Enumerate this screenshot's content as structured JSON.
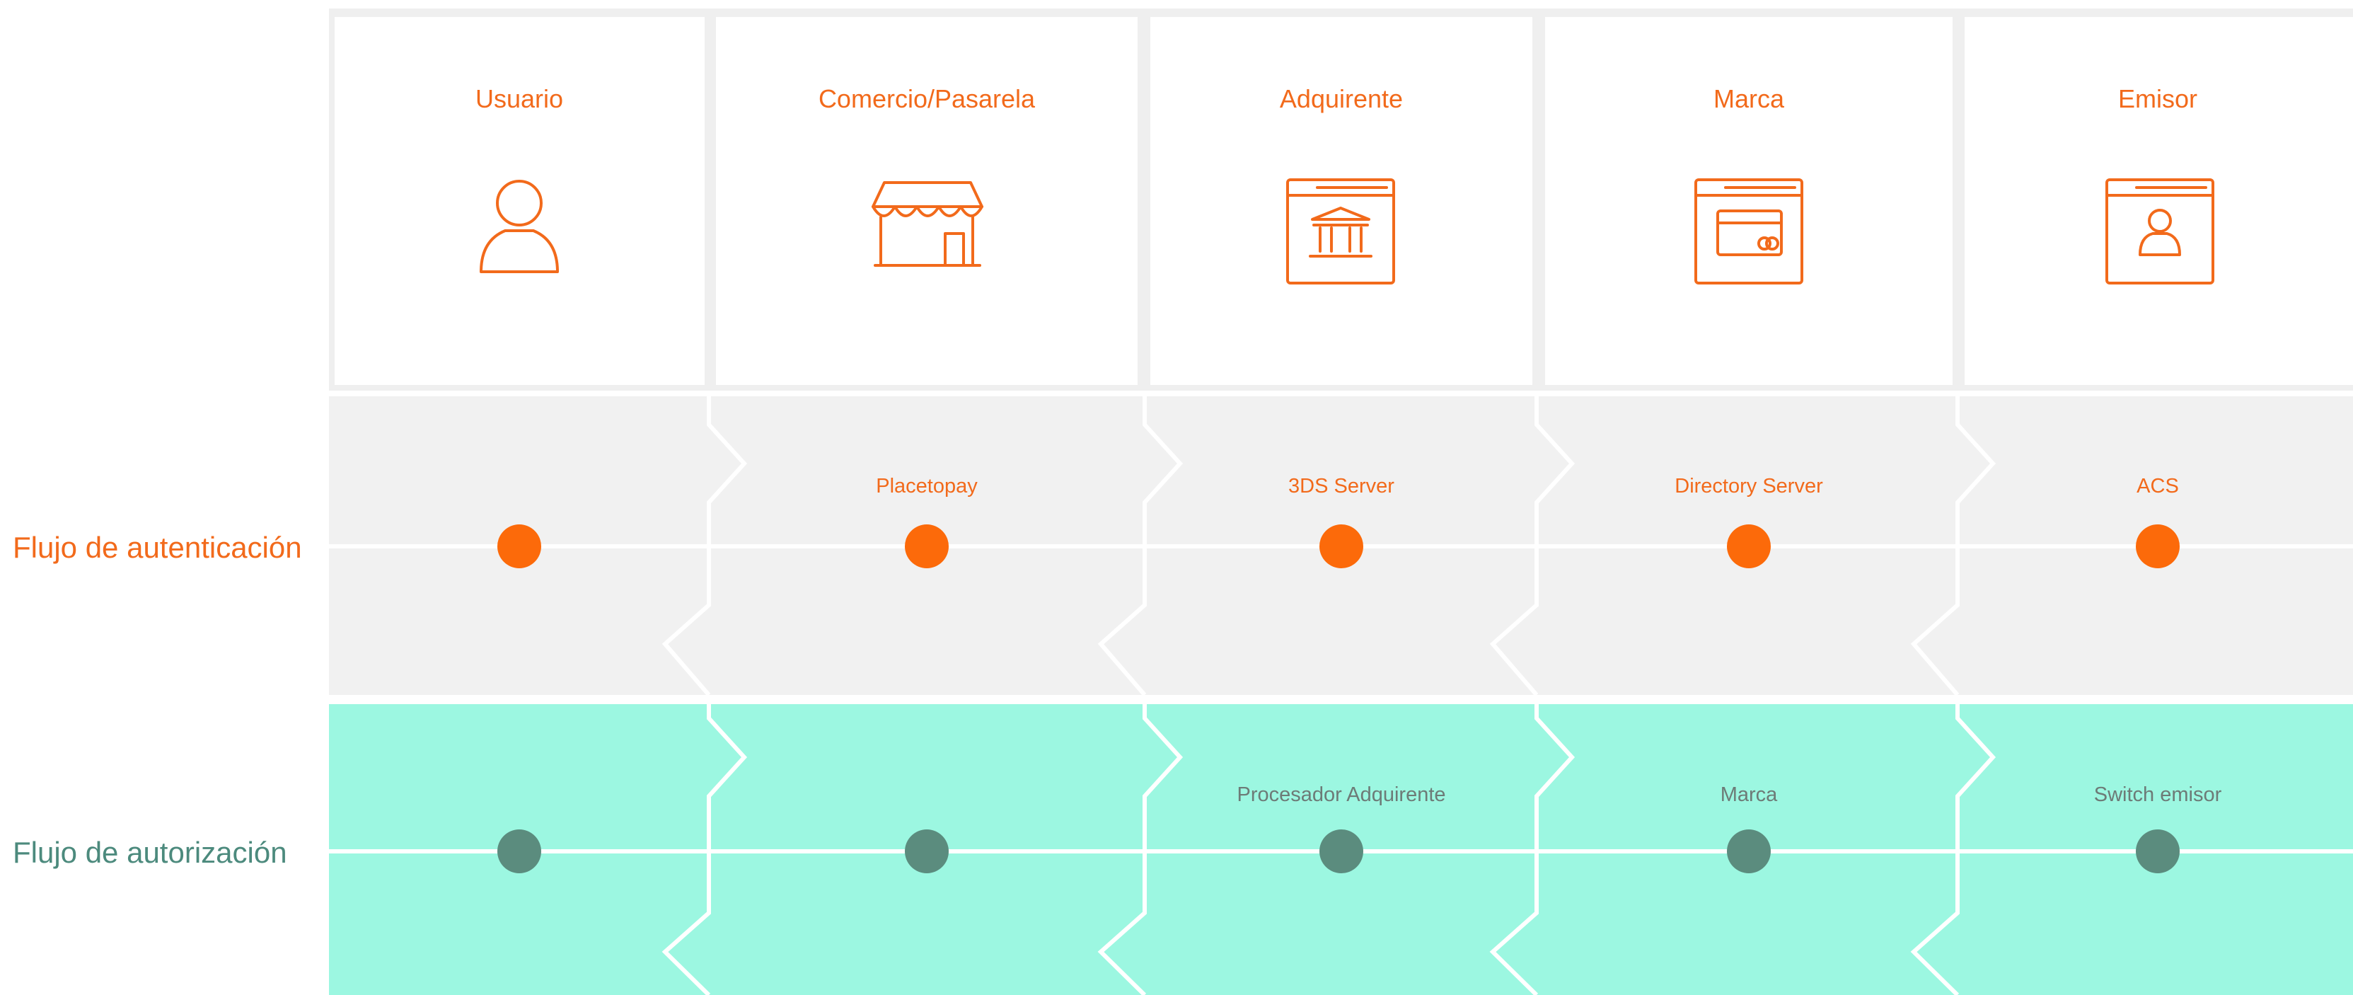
{
  "columns": [
    {
      "title": "Usuario",
      "icon": "user-icon"
    },
    {
      "title": "Comercio/Pasarela",
      "icon": "store-icon"
    },
    {
      "title": "Adquirente",
      "icon": "bank-window-icon"
    },
    {
      "title": "Marca",
      "icon": "card-window-icon"
    },
    {
      "title": "Emisor",
      "icon": "person-window-icon"
    }
  ],
  "rows": {
    "authentication": {
      "label": "Flujo de autenticación",
      "label_color": "#f26a1b",
      "dot_color": "#fc6a0a",
      "band_color": "#f1f1f1",
      "node_labels": [
        "",
        "Placetopay",
        "3DS Server",
        "Directory Server",
        "ACS"
      ]
    },
    "authorization": {
      "label": "Flujo de autorización",
      "label_color": "#4c8a7d",
      "dot_color": "#5b8c7e",
      "band_color": "#9cf7e1",
      "node_labels": [
        "",
        "",
        "Procesador Adquirente",
        "Marca",
        "Switch emisor"
      ]
    }
  },
  "colors": {
    "accent": "#f26a1b",
    "header_background": "#efefef",
    "node_label_authentication": "#f26a1b",
    "node_label_authorization": "#6d7b77"
  }
}
